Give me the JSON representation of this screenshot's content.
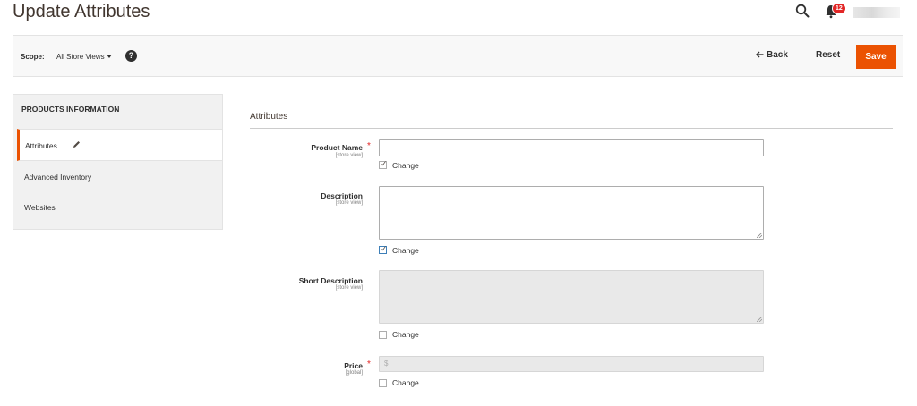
{
  "page": {
    "title": "Update Attributes"
  },
  "header": {
    "notifications_count": "12"
  },
  "toolbar": {
    "scope_label": "Scope:",
    "scope_value": "All Store Views",
    "help_label": "?",
    "back_label": "Back",
    "reset_label": "Reset",
    "save_label": "Save"
  },
  "sidebar": {
    "title": "PRODUCTS INFORMATION",
    "items": [
      {
        "label": "Attributes",
        "active": true
      },
      {
        "label": "Advanced Inventory"
      },
      {
        "label": "Websites"
      }
    ]
  },
  "section": {
    "title": "Attributes"
  },
  "fields": [
    {
      "label": "Product Name",
      "scope": "[store view]",
      "required": true,
      "type": "text",
      "value": "",
      "disabled": false,
      "change_label": "Change",
      "change_checked": true
    },
    {
      "label": "Description",
      "scope": "[store view]",
      "required": false,
      "type": "textarea",
      "value": "",
      "disabled": false,
      "change_label": "Change",
      "change_checked": true
    },
    {
      "label": "Short Description",
      "scope": "[store view]",
      "required": false,
      "type": "textarea",
      "value": "",
      "disabled": true,
      "change_label": "Change",
      "change_checked": false
    },
    {
      "label": "Price",
      "scope": "[global]",
      "required": true,
      "type": "price",
      "prefix": "$",
      "value": "",
      "disabled": true,
      "change_label": "Change",
      "change_checked": false
    }
  ],
  "colors": {
    "accent": "#eb5202",
    "required": "#e22626",
    "badge": "#e22626"
  },
  "icons": [
    "search-icon",
    "bell-icon",
    "help-icon",
    "back-arrow-icon",
    "pencil-icon"
  ]
}
